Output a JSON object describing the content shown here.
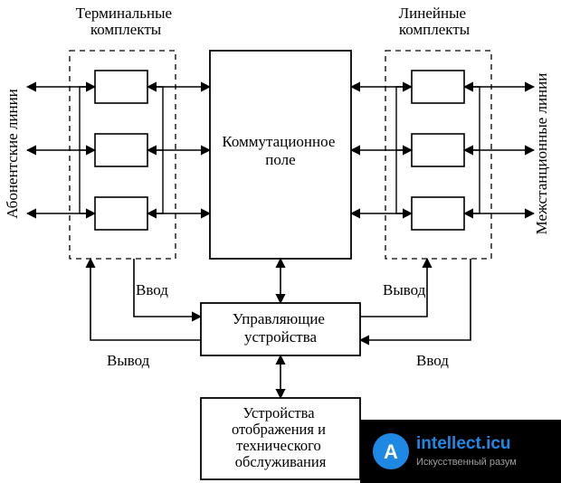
{
  "labels": {
    "terminal_sets": "Терминальные комплекты",
    "line_sets": "Линейные комплекты",
    "subscriber_lines": "Абонентские линии",
    "interstation_lines": "Межстанционные линии",
    "switch_field": "Коммутационное поле",
    "control_units": "Управляющие устройства",
    "display_maint": "Устройства отображения и технического обслуживания",
    "input": "Ввод",
    "output": "Вывод"
  },
  "watermark": {
    "brand": "intellect.icu",
    "tagline": "Искусственный разум"
  },
  "colors": {
    "brand_blue": "#1E88E5",
    "brand_gray": "#9E9E9E",
    "stroke": "#000000"
  },
  "chart_data": {
    "type": "diagram",
    "title": "",
    "nodes": [
      {
        "id": "terminal_sets",
        "label": "Терминальные комплекты",
        "kind": "group",
        "children": [
          "t1",
          "t2",
          "t3"
        ]
      },
      {
        "id": "t1",
        "label": "",
        "kind": "block"
      },
      {
        "id": "t2",
        "label": "",
        "kind": "block"
      },
      {
        "id": "t3",
        "label": "",
        "kind": "block"
      },
      {
        "id": "line_sets",
        "label": "Линейные комплекты",
        "kind": "group",
        "children": [
          "l1",
          "l2",
          "l3"
        ]
      },
      {
        "id": "l1",
        "label": "",
        "kind": "block"
      },
      {
        "id": "l2",
        "label": "",
        "kind": "block"
      },
      {
        "id": "l3",
        "label": "",
        "kind": "block"
      },
      {
        "id": "switch_field",
        "label": "Коммутационное поле",
        "kind": "block"
      },
      {
        "id": "control_units",
        "label": "Управляющие устройства",
        "kind": "block"
      },
      {
        "id": "display_maintenance",
        "label": "Устройства отображения и технического обслуживания",
        "kind": "block"
      }
    ],
    "edges": [
      {
        "from": "subscriber_lines",
        "to": "t1",
        "bidir": true,
        "label": "Абонентские линии"
      },
      {
        "from": "subscriber_lines",
        "to": "t2",
        "bidir": true
      },
      {
        "from": "subscriber_lines",
        "to": "t3",
        "bidir": true
      },
      {
        "from": "t1",
        "to": "switch_field",
        "bidir": true
      },
      {
        "from": "t2",
        "to": "switch_field",
        "bidir": true
      },
      {
        "from": "t3",
        "to": "switch_field",
        "bidir": true
      },
      {
        "from": "switch_field",
        "to": "l1",
        "bidir": true
      },
      {
        "from": "switch_field",
        "to": "l2",
        "bidir": true
      },
      {
        "from": "switch_field",
        "to": "l3",
        "bidir": true
      },
      {
        "from": "l1",
        "to": "interstation_lines",
        "bidir": true,
        "label": "Межстанционные линии"
      },
      {
        "from": "l2",
        "to": "interstation_lines",
        "bidir": true
      },
      {
        "from": "l3",
        "to": "interstation_lines",
        "bidir": true
      },
      {
        "from": "terminal_sets",
        "to": "control_units",
        "bidir": false,
        "label": "Ввод"
      },
      {
        "from": "control_units",
        "to": "terminal_sets",
        "bidir": false,
        "label": "Вывод"
      },
      {
        "from": "line_sets",
        "to": "control_units",
        "bidir": false,
        "label": "Ввод"
      },
      {
        "from": "control_units",
        "to": "line_sets",
        "bidir": false,
        "label": "Вывод"
      },
      {
        "from": "switch_field",
        "to": "control_units",
        "bidir": true
      },
      {
        "from": "control_units",
        "to": "display_maintenance",
        "bidir": true
      }
    ]
  }
}
